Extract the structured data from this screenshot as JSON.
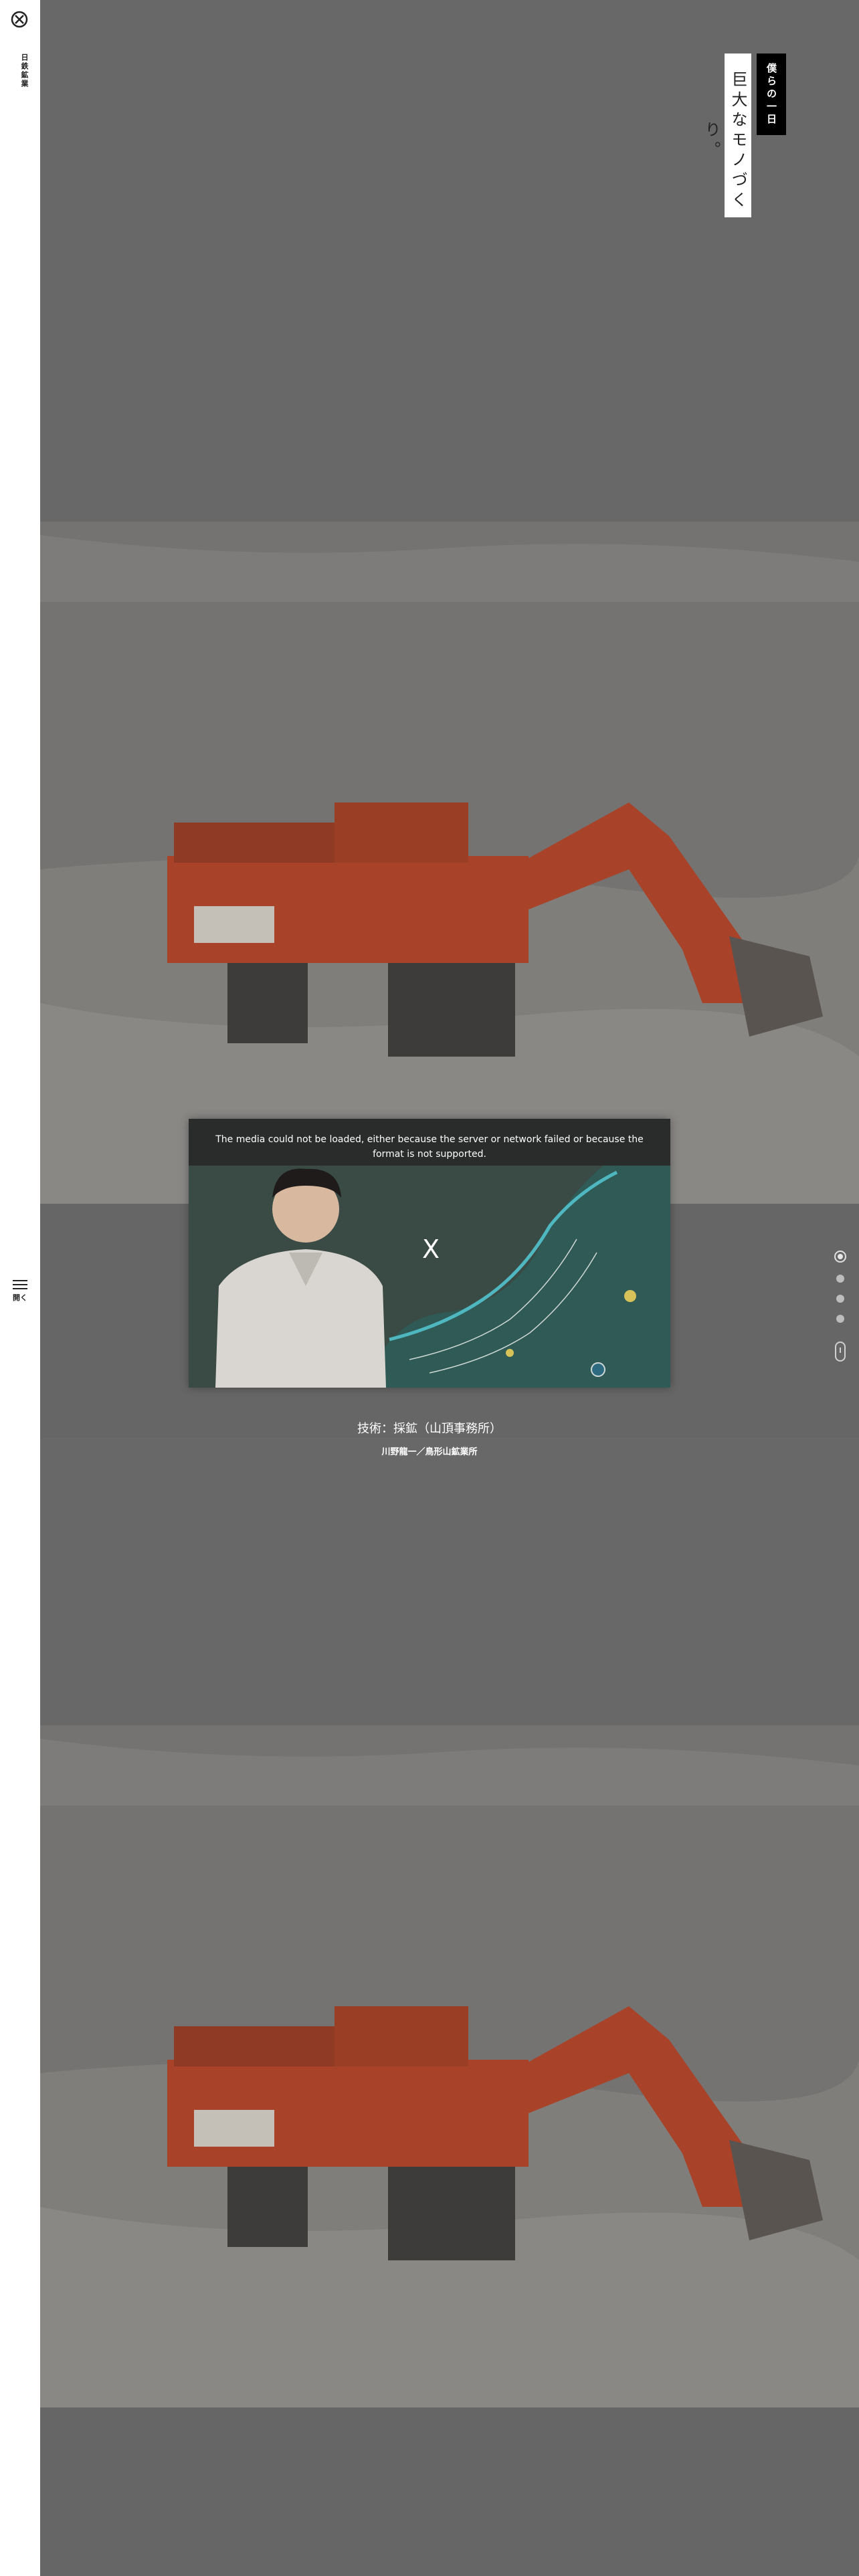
{
  "sidebar": {
    "brand": "日鉄鉱業",
    "menu_label": "開く"
  },
  "header": {
    "title": "巨大なモノづくり。",
    "subtitle": "僕らの一日"
  },
  "video": {
    "error_message": "The media could not be loaded, either because the server or network failed or because the format is not supported.",
    "close_symbol": "X",
    "caption_title": "技術：採鉱（山頂事務所）",
    "caption_sub": "川野龍一／鳥形山鉱業所"
  },
  "pager": {
    "dots": 4,
    "active_index": 0
  },
  "colors": {
    "overlay": "#666666",
    "excavator": "#b4452a",
    "sidebar": "#ffffff",
    "subtitle_bg": "#000000"
  }
}
